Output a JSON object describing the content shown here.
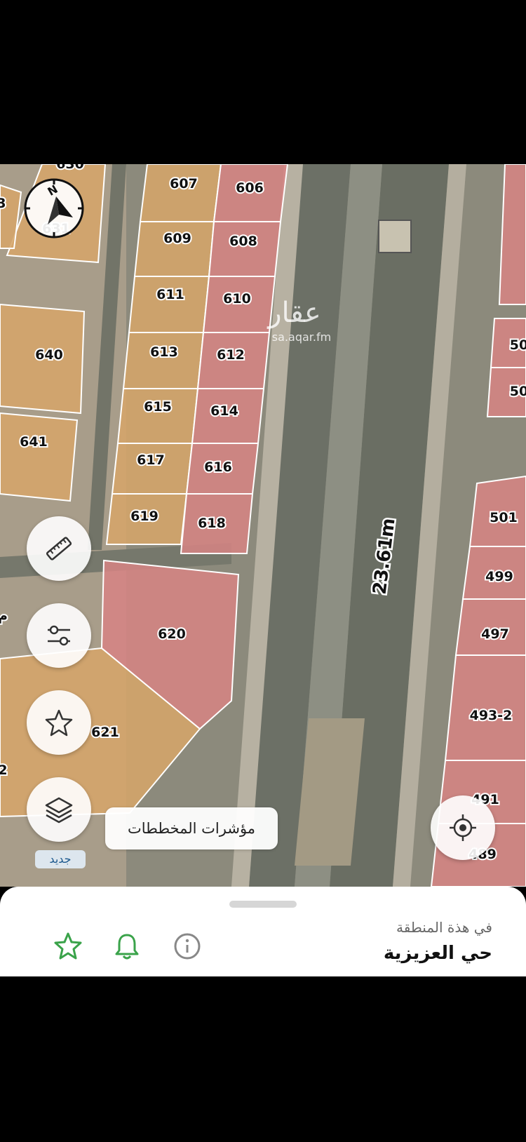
{
  "map": {
    "plots": [
      {
        "label": "630"
      },
      {
        "label": "607"
      },
      {
        "label": "606"
      },
      {
        "label": "631"
      },
      {
        "label": "609"
      },
      {
        "label": "608"
      },
      {
        "label": "611"
      },
      {
        "label": "610"
      },
      {
        "label": "613"
      },
      {
        "label": "612"
      },
      {
        "label": "640"
      },
      {
        "label": "615"
      },
      {
        "label": "614"
      },
      {
        "label": "641"
      },
      {
        "label": "617"
      },
      {
        "label": "616"
      },
      {
        "label": "619"
      },
      {
        "label": "618"
      },
      {
        "label": "620"
      },
      {
        "label": "621"
      },
      {
        "label": "501"
      },
      {
        "label": "499"
      },
      {
        "label": "497"
      },
      {
        "label": "493-2"
      },
      {
        "label": "491"
      },
      {
        "label": "489"
      },
      {
        "label": "50"
      },
      {
        "label": "50"
      },
      {
        "label": "2"
      },
      {
        "label": "م"
      },
      {
        "label": "3"
      }
    ],
    "road_measurement": "23.61m",
    "watermark": {
      "logo_text": "عقار",
      "url_text": "sa.aqar.fm"
    },
    "colors": {
      "residential_plot": "#d5a56a",
      "commercial_plot": "#d78484",
      "road": "#6f7467",
      "median": "#b9b4a8"
    }
  },
  "controls": {
    "compass": {
      "letter": "N"
    },
    "buttons": [
      {
        "icon": "ruler-icon"
      },
      {
        "icon": "sliders-icon"
      },
      {
        "icon": "star-icon"
      },
      {
        "icon": "layers-icon"
      },
      {
        "icon": "locate-icon"
      }
    ],
    "layers_badge": "جديد",
    "tooltip": "مؤشرات المخططات"
  },
  "bottom_sheet": {
    "subtitle": "في هذة المنطقة",
    "title": "حي العزيزية",
    "icons": [
      "star-outline-icon",
      "bell-icon",
      "info-icon"
    ],
    "accent_color": "#3aa34a"
  }
}
